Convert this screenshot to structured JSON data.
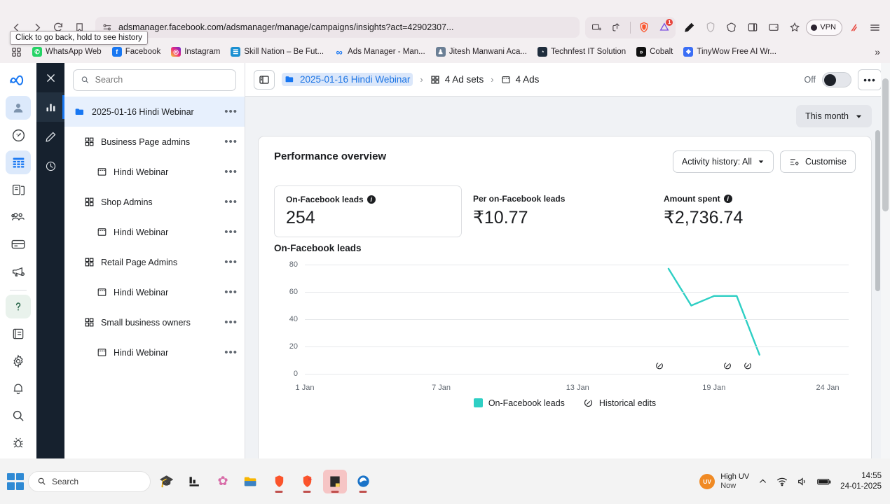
{
  "browser": {
    "url": "adsmanager.facebook.com/adsmanager/manage/campaigns/insights?act=42902307...",
    "back_tooltip": "Click to go back, hold to see history",
    "vpn_label": "VPN",
    "notification_badge": "1",
    "overflow_label": "»",
    "bookmarks": [
      {
        "label": "WhatsApp Web",
        "icon": "whatsapp-icon",
        "color": "#25d366",
        "glyph": "✆"
      },
      {
        "label": "Facebook",
        "icon": "facebook-icon",
        "color": "#1877f2",
        "glyph": "f"
      },
      {
        "label": "Instagram",
        "icon": "instagram-icon",
        "color": "#e1306c",
        "glyph": "◎"
      },
      {
        "label": "Skill Nation – Be Fut...",
        "icon": "skill-nation-icon",
        "color": "#1a8fd1",
        "glyph": "☰"
      },
      {
        "label": "Ads Manager - Man...",
        "icon": "meta-icon",
        "color": "#1877f2",
        "glyph": "∞"
      },
      {
        "label": "Jitesh Manwani Aca...",
        "icon": "avatar-icon",
        "color": "#6b7f95",
        "glyph": "♟"
      },
      {
        "label": "Technfest IT Solution",
        "icon": "globe-icon",
        "color": "#1f2d3d",
        "glyph": "◔"
      },
      {
        "label": "Cobalt",
        "icon": "cobalt-icon",
        "color": "#111111",
        "glyph": "»"
      },
      {
        "label": "TinyWow Free AI Wr...",
        "icon": "tinywow-icon",
        "color": "#3b6ef5",
        "glyph": "❖"
      }
    ]
  },
  "meta_rail": [
    {
      "name": "meta-logo-icon",
      "glyph": "meta"
    },
    {
      "name": "account-avatar-icon",
      "glyph": "avatar"
    },
    {
      "name": "gauge-icon",
      "glyph": "gauge"
    },
    {
      "name": "table-view-icon",
      "glyph": "table",
      "selected": true
    },
    {
      "name": "pages-icon",
      "glyph": "pages"
    },
    {
      "name": "audience-icon",
      "glyph": "audience"
    },
    {
      "name": "billing-icon",
      "glyph": "card"
    },
    {
      "name": "megaphone-icon",
      "glyph": "megaphone"
    },
    {
      "name": "help-icon",
      "glyph": "help"
    },
    {
      "name": "documents-icon",
      "glyph": "doc"
    },
    {
      "name": "settings-gear-icon",
      "glyph": "gear"
    },
    {
      "name": "notifications-bell-icon",
      "glyph": "bell"
    },
    {
      "name": "search-icon",
      "glyph": "search"
    },
    {
      "name": "bug-report-icon",
      "glyph": "bug"
    }
  ],
  "dark_rail": [
    {
      "name": "close-panel-icon",
      "glyph": "x"
    },
    {
      "name": "insights-chart-icon",
      "glyph": "chart",
      "active": true
    },
    {
      "name": "edit-pencil-icon",
      "glyph": "pencil"
    },
    {
      "name": "history-clock-icon",
      "glyph": "clock"
    }
  ],
  "sidebar": {
    "search_placeholder": "Search",
    "search_value": "",
    "menu_dots": "•••",
    "items": [
      {
        "label": "2025-01-16 Hindi Webinar",
        "icon": "campaign-folder-icon",
        "level": 0,
        "selected": true
      },
      {
        "label": "Business Page admins",
        "icon": "adset-grid-icon",
        "level": 1,
        "selected": false
      },
      {
        "label": "Hindi Webinar",
        "icon": "ad-window-icon",
        "level": 2,
        "selected": false
      },
      {
        "label": "Shop Admins",
        "icon": "adset-grid-icon",
        "level": 1,
        "selected": false
      },
      {
        "label": "Hindi Webinar",
        "icon": "ad-window-icon",
        "level": 2,
        "selected": false
      },
      {
        "label": "Retail Page Admins",
        "icon": "adset-grid-icon",
        "level": 1,
        "selected": false
      },
      {
        "label": "Hindi Webinar",
        "icon": "ad-window-icon",
        "level": 2,
        "selected": false
      },
      {
        "label": "Small business owners",
        "icon": "adset-grid-icon",
        "level": 1,
        "selected": false
      },
      {
        "label": "Hindi Webinar",
        "icon": "ad-window-icon",
        "level": 2,
        "selected": false
      }
    ]
  },
  "breadcrumb": {
    "campaign": "2025-01-16 Hindi Webinar",
    "adsets": "4 Ad sets",
    "ads": "4 Ads",
    "separator": "›",
    "off_label": "Off",
    "more_label": "•••"
  },
  "date_selector": {
    "label": "This month"
  },
  "overview": {
    "title": "Performance overview",
    "activity_history_label": "Activity history: All",
    "customise_label": "Customise",
    "metrics": [
      {
        "label": "On-Facebook leads",
        "value": "254",
        "has_info": true,
        "boxed": true
      },
      {
        "label": "Per on-Facebook leads",
        "value": "₹10.77",
        "has_info": false,
        "boxed": false
      },
      {
        "label": "Amount spent",
        "value": "₹2,736.74",
        "has_info": true,
        "boxed": false
      }
    ]
  },
  "chart_data": {
    "type": "line",
    "title": "On-Facebook leads",
    "xlabel": "",
    "ylabel": "",
    "ylim": [
      0,
      80
    ],
    "yticks": [
      0,
      20,
      40,
      60,
      80
    ],
    "xlim": [
      "1 Jan",
      "24 Jan"
    ],
    "xticks": [
      "1 Jan",
      "7 Jan",
      "13 Jan",
      "19 Jan",
      "24 Jan"
    ],
    "xtick_days": [
      1,
      7,
      13,
      19,
      24
    ],
    "grid": true,
    "legend_position": "bottom",
    "series": [
      {
        "name": "On-Facebook leads",
        "color": "#2ecfc4",
        "x_days": [
          17,
          18,
          19,
          20,
          21
        ],
        "values": [
          77,
          50,
          57,
          57,
          14
        ]
      }
    ],
    "annotations": {
      "name": "Historical edits",
      "icon": "historical-edit-icon",
      "x_days": [
        16.6,
        19.6,
        20.5
      ]
    },
    "legend": [
      {
        "label": "On-Facebook leads",
        "marker": "square",
        "color": "#2ecfc4"
      },
      {
        "label": "Historical edits",
        "marker": "edit-icon",
        "color": "#1c1e21"
      }
    ]
  },
  "taskbar": {
    "search_placeholder": "Search",
    "apps": [
      {
        "name": "taskbar-app-education",
        "glyph": "🎓",
        "active": false
      },
      {
        "name": "taskbar-app-charts",
        "glyph": "📊",
        "active": false
      },
      {
        "name": "taskbar-app-copilot",
        "glyph": "✿",
        "active": false
      },
      {
        "name": "taskbar-app-file-explorer",
        "glyph": "📁",
        "active": false
      },
      {
        "name": "taskbar-app-brave",
        "glyph": "🦁",
        "active": false
      },
      {
        "name": "taskbar-app-brave-beta",
        "glyph": "🦁",
        "active": false
      },
      {
        "name": "taskbar-app-notepad",
        "glyph": "📓",
        "active": true
      },
      {
        "name": "taskbar-app-edge",
        "glyph": "◑",
        "active": false
      }
    ],
    "weather": {
      "title": "High UV",
      "subtitle": "Now",
      "badge": "UV"
    },
    "clock": {
      "time": "14:55",
      "date": "24-01-2025"
    }
  }
}
